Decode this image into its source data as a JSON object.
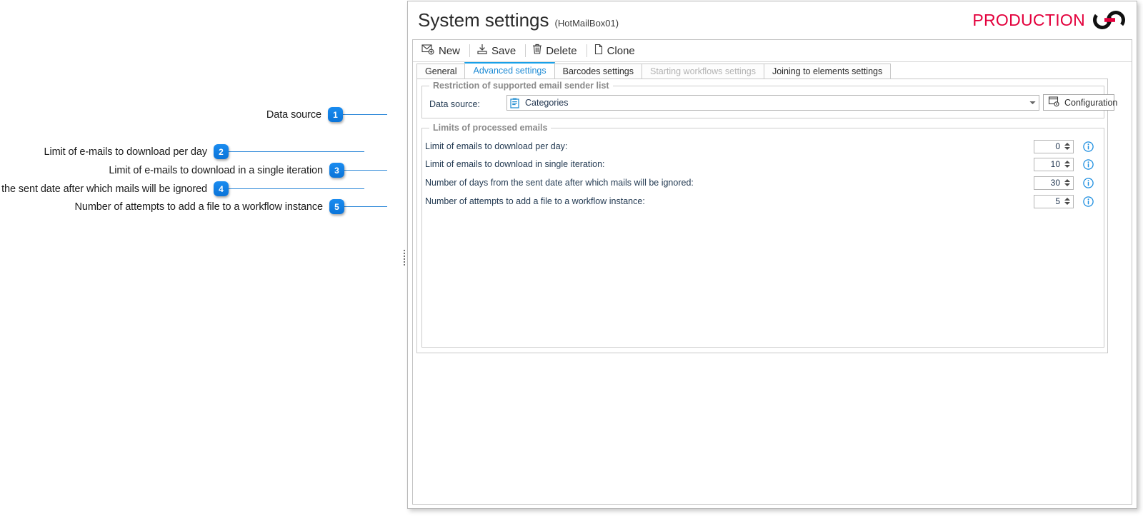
{
  "window": {
    "title": "System settings",
    "subtitle": "(HotMailBox01)",
    "brand_text": "PRODUCTION",
    "brand_color": "#e3003c",
    "logo_icon": "chain-link-logo"
  },
  "toolbar": {
    "buttons": [
      {
        "label": "New",
        "icon": "new-mail-icon"
      },
      {
        "label": "Save",
        "icon": "save-icon"
      },
      {
        "label": "Delete",
        "icon": "trash-icon"
      },
      {
        "label": "Clone",
        "icon": "copy-page-icon"
      }
    ]
  },
  "tabs": [
    {
      "label": "General",
      "state": "normal"
    },
    {
      "label": "Advanced settings",
      "state": "active"
    },
    {
      "label": "Barcodes settings",
      "state": "normal"
    },
    {
      "label": "Starting workflows settings",
      "state": "disabled"
    },
    {
      "label": "Joining to elements settings",
      "state": "normal"
    }
  ],
  "restriction_group": {
    "title": "Restriction of supported email sender list",
    "data_source_label": "Data source:",
    "data_source_value": "Categories",
    "data_source_icon": "list-document-icon",
    "dropdown_icon": "chevron-down-icon",
    "configuration_label": "Configuration",
    "configuration_icon": "form-gear-icon"
  },
  "limits_group": {
    "title": "Limits of processed emails",
    "rows": [
      {
        "label": "Limit of emails to download per day:",
        "value": "0",
        "info_icon": "info-icon"
      },
      {
        "label": "Limit of emails to download in single iteration:",
        "value": "10",
        "info_icon": "info-icon"
      },
      {
        "label": "Number of days from the sent date after which mails will be ignored:",
        "value": "30",
        "info_icon": "info-icon"
      },
      {
        "label": "Number of attempts to add a file to a workflow instance:",
        "value": "5",
        "info_icon": "info-icon"
      }
    ]
  },
  "annotations": {
    "accent_color": "#0b74d8",
    "items": [
      {
        "number": "1",
        "text": "Data source"
      },
      {
        "number": "2",
        "text": "Limit of e-mails to download per day"
      },
      {
        "number": "3",
        "text": "Limit of e-mails to download in a single iteration"
      },
      {
        "number": "4",
        "text": "Number of days from the sent date after which mails will be ignored"
      },
      {
        "number": "5",
        "text": "Number of attempts to add a file to a workflow instance"
      }
    ]
  }
}
